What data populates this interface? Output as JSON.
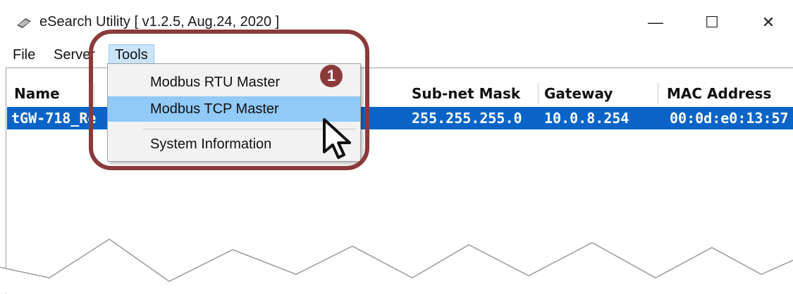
{
  "window": {
    "title": "eSearch Utility [ v1.2.5, Aug.24, 2020 ]",
    "controls": {
      "minimize": "—",
      "maximize": "☐",
      "close": "✕"
    }
  },
  "menubar": {
    "file": "File",
    "server": "Server",
    "tools": "Tools"
  },
  "tools_menu": {
    "items": [
      "Modbus RTU Master",
      "Modbus TCP Master",
      "System Information"
    ],
    "hovered": "Modbus TCP Master"
  },
  "table": {
    "columns": [
      "Name",
      "Sub-net Mask",
      "Gateway",
      "MAC Address"
    ],
    "rows": [
      {
        "name": "tGW-718_Re",
        "subnet": "255.255.255.0",
        "gateway": "10.0.8.254",
        "mac": "00:0d:e0:13:57"
      }
    ]
  },
  "annotation": {
    "step": "1"
  },
  "colors": {
    "accent": "#8b3a3a",
    "selection": "#0a64c8",
    "hover": "#91c9f7"
  }
}
